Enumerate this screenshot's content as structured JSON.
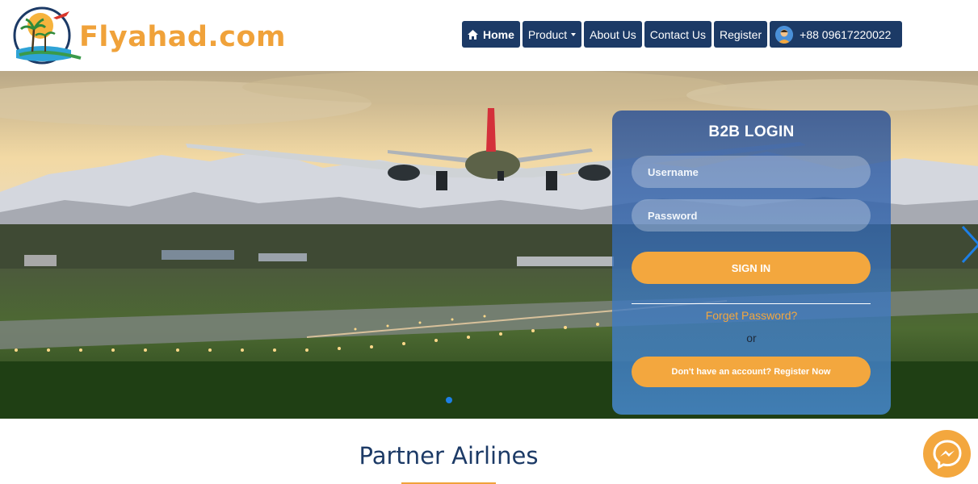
{
  "brand": {
    "name": "Flyahad.com",
    "accent_color": "#f0a23a",
    "nav_color": "#1c3a66"
  },
  "nav": {
    "items": [
      {
        "label": "Home",
        "icon": "home-icon"
      },
      {
        "label": "Product",
        "icon": "caret-down-icon"
      },
      {
        "label": "About Us"
      },
      {
        "label": "Contact Us"
      },
      {
        "label": "Register"
      }
    ],
    "phone": {
      "label": "+88 09617220022",
      "icon": "avatar-icon"
    }
  },
  "hero": {
    "slide_indicator": "dot-active",
    "next_icon": "chevron-right-icon"
  },
  "login": {
    "title": "B2B LOGIN",
    "username_placeholder": "Username",
    "password_placeholder": "Password",
    "signin_label": "SIGN IN",
    "forget_label": "Forget Password?",
    "or_label": "or",
    "register_label": "Don't have an account? Register Now"
  },
  "partners": {
    "title": "Partner Airlines"
  },
  "messenger": {
    "icon": "messenger-icon"
  }
}
